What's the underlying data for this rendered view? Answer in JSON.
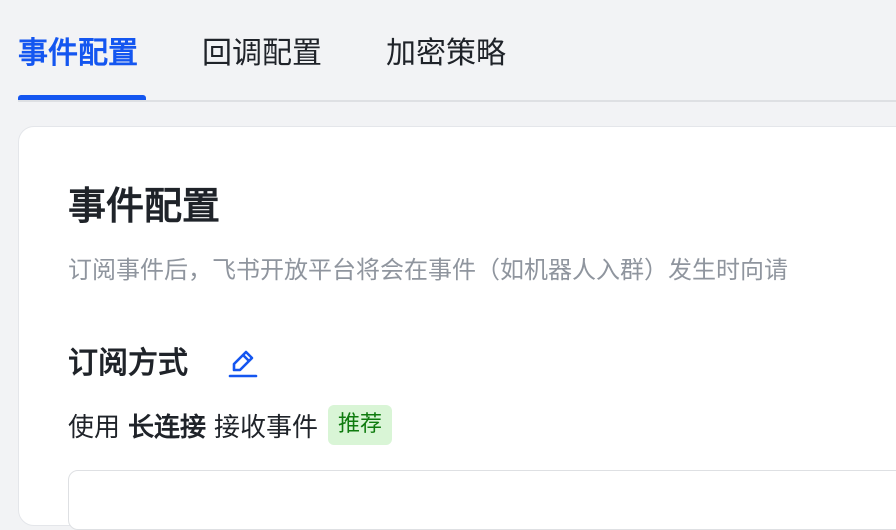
{
  "tabs": [
    {
      "label": "事件配置",
      "active": true
    },
    {
      "label": "回调配置",
      "active": false
    },
    {
      "label": "加密策略",
      "active": false
    }
  ],
  "card": {
    "title": "事件配置",
    "description": "订阅事件后，飞书开放平台将会在事件（如机器人入群）发生时向请"
  },
  "subscription": {
    "title": "订阅方式",
    "edit_icon": "pencil-icon",
    "prefix": "使用",
    "mode": "长连接",
    "suffix": "接收事件",
    "badge": "推荐"
  },
  "colors": {
    "accent": "#1456f0",
    "badge_bg": "#d9f5d6",
    "badge_text": "#0f7b0f",
    "muted_text": "#8f959e"
  }
}
